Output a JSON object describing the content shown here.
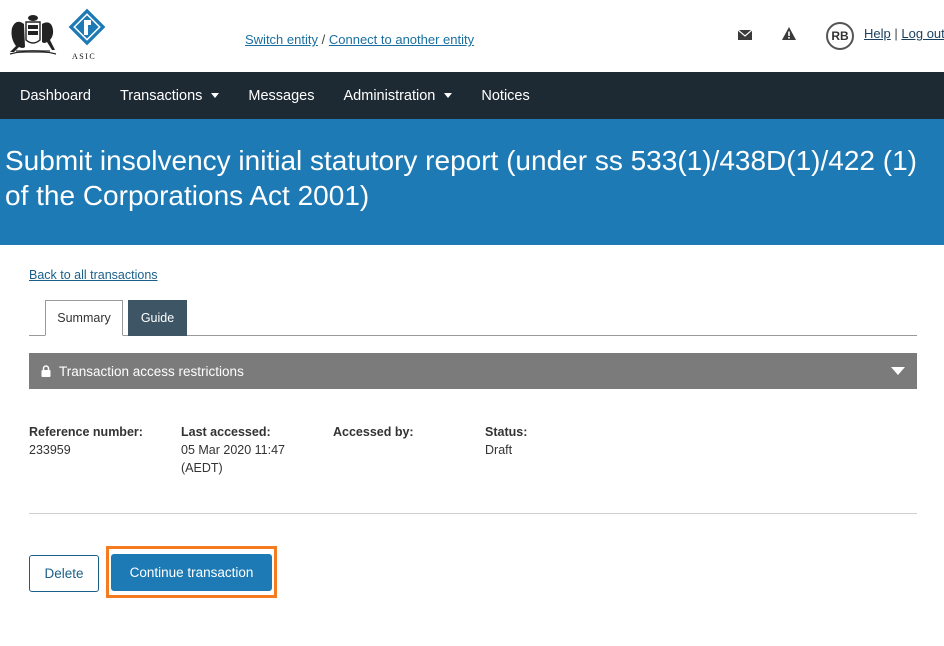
{
  "header": {
    "asic_text": "ASIC",
    "switch_entity": "Switch entity",
    "separator": "/",
    "connect_entity": "Connect to another entity",
    "avatar_initials": "RB",
    "help": "Help",
    "help_separator": "|",
    "logout": "Log out"
  },
  "nav": {
    "items": [
      {
        "label": "Dashboard"
      },
      {
        "label": "Transactions"
      },
      {
        "label": "Messages"
      },
      {
        "label": "Administration"
      },
      {
        "label": "Notices"
      }
    ]
  },
  "page": {
    "title": "Submit insolvency initial statutory report (under ss 533(1)/438D(1)/422 (1) of the Corporations Act 2001)",
    "back_link": "Back to all transactions",
    "tabs": [
      {
        "label": "Summary"
      },
      {
        "label": "Guide"
      }
    ],
    "restrictions": "Transaction access restrictions",
    "meta": {
      "reference_label": "Reference number:",
      "reference_value": "233959",
      "last_accessed_label": "Last accessed:",
      "last_accessed_value": "05 Mar 2020 11:47 (AEDT)",
      "accessed_by_label": "Accessed by:",
      "accessed_by_value": "",
      "status_label": "Status:",
      "status_value": "Draft"
    },
    "delete_button": "Delete",
    "continue_button": "Continue transaction"
  },
  "colors": {
    "nav_bg": "#1e2a33",
    "banner_bg": "#1d7ab5",
    "highlight": "#f47b20",
    "guide_tab": "#3d5565",
    "restrictions_bg": "#7b7b7b"
  },
  "icons": [
    "coat-of-arms-icon",
    "asic-logo-icon",
    "mail-icon",
    "alert-icon",
    "lock-icon",
    "chevron-down-icon"
  ]
}
